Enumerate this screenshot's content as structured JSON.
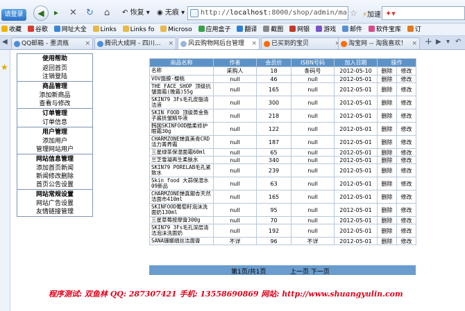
{
  "browser": {
    "login_label": "请登录",
    "restore_label": "恢复",
    "trace_label": "无痕",
    "url_prefix": "http://",
    "url_host": "localhost",
    "url_rest": ":8000/shop/admin/mar",
    "speed_label": "加速"
  },
  "favorites": [
    {
      "label": "收藏"
    },
    {
      "label": "谷歌"
    },
    {
      "label": "网址大全"
    },
    {
      "label": "Links"
    },
    {
      "label": "Links fo"
    },
    {
      "label": "Microso"
    },
    {
      "label": "应用盒子"
    },
    {
      "label": "翻译"
    },
    {
      "label": "截图"
    },
    {
      "label": "网银"
    },
    {
      "label": "游戏"
    },
    {
      "label": "邮件"
    },
    {
      "label": "软件宝库"
    },
    {
      "label": "订"
    }
  ],
  "tabs": [
    {
      "label": "QQ邮箱 - 墨流瓶"
    },
    {
      "label": "腾讯大成网 - 四川..."
    },
    {
      "label": "风云购物网后台管理"
    },
    {
      "label": "已买到的宝贝"
    },
    {
      "label": "淘宝网 -- 淘我喜欢！"
    }
  ],
  "menu": [
    {
      "title": "使用帮助",
      "items": [
        "返回首页",
        "注销登陆"
      ]
    },
    {
      "title": "商品管理",
      "items": [
        "添加新商品",
        "查看与修改"
      ]
    },
    {
      "title": "订单管理",
      "items": [
        "订单信息"
      ]
    },
    {
      "title": "用户管理",
      "items": [
        "添加用户",
        "管理网站用户"
      ]
    },
    {
      "title": "网站信息管理",
      "items": [
        "添加首页新闻",
        "新闻修改删除",
        "首页公告设置"
      ]
    },
    {
      "title": "网站常规设置",
      "items": [
        "网站广告设置",
        "友情链接管理"
      ]
    }
  ],
  "table": {
    "headers": [
      "商品名称",
      "作者",
      "会员价",
      "ISBN号码",
      "加入日期",
      "操作"
    ],
    "first_row": [
      "名称",
      "采购人",
      "18",
      "条码号",
      "2012-05-10",
      "删除",
      "修改"
    ],
    "rows": [
      {
        "name": "VOV面膜-樱桃",
        "author": "null",
        "price": "46",
        "isbn": "null",
        "date": "2012-05-01",
        "del": "删除",
        "edit": "修改",
        "tall": false
      },
      {
        "name": "THE FACE SHOP 顶级抗皱面霜(晚霜)55g",
        "author": "null",
        "price": "165",
        "isbn": "null",
        "date": "2012-05-01",
        "del": "删除",
        "edit": "修改",
        "tall": true
      },
      {
        "name": "SKIN79 3Fs毛孔皮脂清洁液",
        "author": "null",
        "price": "300",
        "isbn": "null",
        "date": "2012-05-01",
        "del": "删除",
        "edit": "修改",
        "tall": true
      },
      {
        "name": "SKIN FOOD 顶级黄金鱼子酱抚皱精华液",
        "author": "null",
        "price": "218",
        "isbn": "null",
        "date": "2012-05-01",
        "del": "删除",
        "edit": "修改",
        "tall": true
      },
      {
        "name": "韩国SKINFOOD酷柔修护眼霜30g",
        "author": "null",
        "price": "122",
        "isbn": "null",
        "date": "2012-05-01",
        "del": "删除",
        "edit": "修改",
        "tall": true
      },
      {
        "name": "CHARMZONE婵真美青CRD活力菁养霜",
        "author": "null",
        "price": "187",
        "isbn": "null",
        "date": "2012-05-01",
        "del": "删除",
        "edit": "修改",
        "tall": true
      },
      {
        "name": "三星绿茶保湿面霜60ml",
        "author": "null",
        "price": "65",
        "isbn": "null",
        "date": "2012-05-01",
        "del": "删除",
        "edit": "修改",
        "tall": false
      },
      {
        "name": "兰芝雪凝再生柔肤水",
        "author": "null",
        "price": "340",
        "isbn": "null",
        "date": "2012-05-01",
        "del": "删除",
        "edit": "修改",
        "tall": false
      },
      {
        "name": "SKIN79 PORELAB毛孔紧致水",
        "author": "null",
        "price": "239",
        "isbn": "null",
        "date": "2012-05-01",
        "del": "删除",
        "edit": "修改",
        "tall": true
      },
      {
        "name": "Skin food 大蒜保湿水09新品",
        "author": "null",
        "price": "63",
        "isbn": "null",
        "date": "2012-05-01",
        "del": "删除",
        "edit": "修改",
        "tall": true
      },
      {
        "name": "CHARMZONE婵真銀杏天然洁面市410ml",
        "author": "null",
        "price": "165",
        "isbn": "null",
        "date": "2012-05-01",
        "del": "删除",
        "edit": "修改",
        "tall": true
      },
      {
        "name": "SKINFOOD葡萄籽泡沫洗面奶130ml",
        "author": "null",
        "price": "95",
        "isbn": "null",
        "date": "2012-05-01",
        "del": "删除",
        "edit": "修改",
        "tall": true
      },
      {
        "name": "三星草莓按摩膏300g",
        "author": "null",
        "price": "70",
        "isbn": "null",
        "date": "2012-05-01",
        "del": "删除",
        "edit": "修改",
        "tall": false
      },
      {
        "name": "SKIN79 3Fs毛孔深层清洁泡沫洗面奶",
        "author": "null",
        "price": "192",
        "isbn": "null",
        "date": "2012-05-01",
        "del": "删除",
        "edit": "修改",
        "tall": true
      },
      {
        "name": "SANA珊娜绢丝洁面膏",
        "author": "不详",
        "price": "96",
        "isbn": "不详",
        "date": "2012-05-01",
        "del": "删除",
        "edit": "修改",
        "tall": false
      }
    ],
    "pager_left": "第1页/共1页",
    "pager_right": "上一页 下一页"
  },
  "credit": "程序测试: 双鱼林   QQ: 287307421   手机: 13558690869   网站: http://www.shuangyulin.com",
  "colors": {
    "header_blue": "#5d92c7",
    "credit_red": "#e0001a"
  }
}
